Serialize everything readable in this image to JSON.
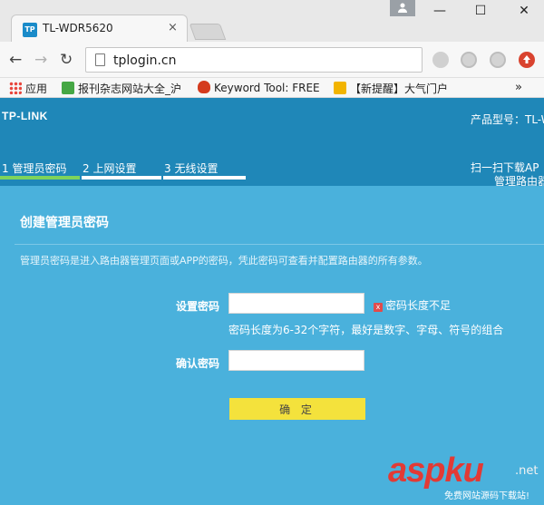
{
  "browser": {
    "tab_title": "TL-WDR5620",
    "tab_favicon": "TP",
    "tab_close": "×",
    "window_minimize": "—",
    "window_maximize": "☐",
    "window_close": "✕",
    "back_glyph": "←",
    "forward_glyph": "→",
    "reload_glyph": "↻",
    "address": "tplogin.cn",
    "bookmarks": [
      {
        "label": "应用",
        "icon": "apps-grid-icon",
        "color": "#e8453c"
      },
      {
        "label": "报刊杂志网站大全_沪",
        "icon": "green-c-icon",
        "color": "#46a745"
      },
      {
        "label": "Keyword Tool: FREE",
        "icon": "flame-icon",
        "color": "#d43b1e"
      },
      {
        "label": "【新提醒】大气门户",
        "icon": "trophy-icon",
        "color": "#f2b400"
      }
    ],
    "more_bookmarks": "»"
  },
  "router": {
    "logo": "TP-LINK",
    "model_label": "产品型号：TL-W",
    "steps": [
      {
        "label": "1 管理员密码",
        "active": true
      },
      {
        "label": "2 上网设置",
        "active": false
      },
      {
        "label": "3 无线设置",
        "active": false
      }
    ],
    "scan_line1": "扫一扫下载AP",
    "scan_line2": "管理路由器"
  },
  "form": {
    "title": "创建管理员密码",
    "description": "管理员密码是进入路由器管理页面或APP的密码，凭此密码可查看并配置路由器的所有参数。",
    "password_label": "设置密码",
    "password_value": "",
    "error_icon": "x",
    "error_text": "密码长度不足",
    "hint": "密码长度为6-32个字符，最好是数字、字母、符号的组合",
    "confirm_label": "确认密码",
    "confirm_value": "",
    "submit_label": "确 定"
  },
  "watermark": {
    "main": "aspku",
    "net": ".net",
    "sub": "免费网站源码下载站!"
  },
  "colors": {
    "header_blue": "#1f87b8",
    "content_blue": "#4ab1dc",
    "active_step": "#7ed35b",
    "button_yellow": "#f4e23c",
    "error_red": "#e24b4b"
  }
}
